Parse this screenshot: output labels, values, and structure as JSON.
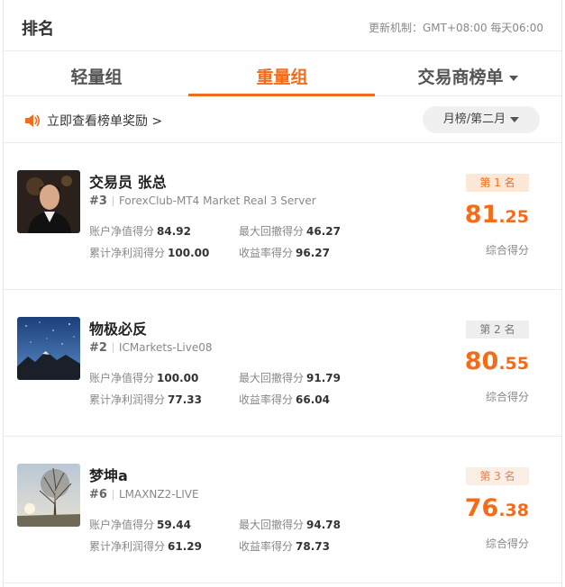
{
  "header": {
    "title": "排名",
    "update_info": "更新机制：GMT+08:00 每天06:00"
  },
  "tabs": [
    {
      "label": "轻量组",
      "active": false
    },
    {
      "label": "重量组",
      "active": true
    },
    {
      "label": "交易商榜单",
      "active": false,
      "has_dropdown": true
    }
  ],
  "subbar": {
    "reward_link": "立即查看榜单奖励 >",
    "period": "月榜/第二月"
  },
  "colors": {
    "accent": "#f26c1a"
  },
  "cards": [
    {
      "name": "交易员 张总",
      "rank_num": "#3",
      "server": "ForexClub-MT4 Market Real 3 Server",
      "badge": "第 1 名",
      "stats": {
        "net_value_label": "账户净值得分",
        "net_value": "84.92",
        "drawdown_label": "最大回撤得分",
        "drawdown": "46.27",
        "profit_label": "累计净利润得分",
        "profit": "100.00",
        "return_label": "收益率得分",
        "return": "96.27"
      },
      "score_int": "81",
      "score_dec": ".25",
      "score_label": "综合得分"
    },
    {
      "name": "物极必反",
      "rank_num": "#2",
      "server": "ICMarkets-Live08",
      "badge": "第 2 名",
      "stats": {
        "net_value_label": "账户净值得分",
        "net_value": "100.00",
        "drawdown_label": "最大回撤得分",
        "drawdown": "91.79",
        "profit_label": "累计净利润得分",
        "profit": "77.33",
        "return_label": "收益率得分",
        "return": "66.04"
      },
      "score_int": "80",
      "score_dec": ".55",
      "score_label": "综合得分"
    },
    {
      "name": "梦坤a",
      "rank_num": "#6",
      "server": "LMAXNZ2-LIVE",
      "badge": "第 3 名",
      "stats": {
        "net_value_label": "账户净值得分",
        "net_value": "59.44",
        "drawdown_label": "最大回撤得分",
        "drawdown": "94.78",
        "profit_label": "累计净利润得分",
        "profit": "61.29",
        "return_label": "收益率得分",
        "return": "78.73"
      },
      "score_int": "76",
      "score_dec": ".38",
      "score_label": "综合得分"
    }
  ]
}
